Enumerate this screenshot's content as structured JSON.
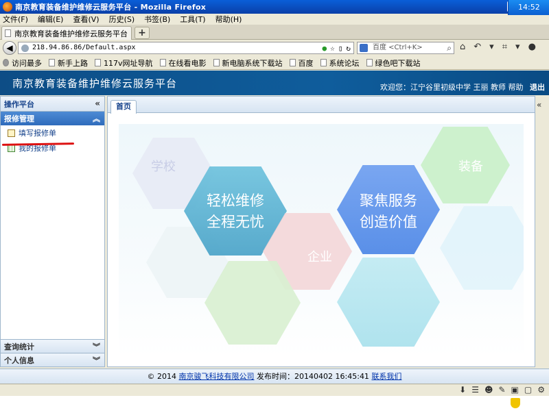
{
  "window": {
    "title": "南京教育装备维护维修云服务平台 - Mozilla Firefox"
  },
  "menu": [
    "文件(F)",
    "编辑(E)",
    "查看(V)",
    "历史(S)",
    "书签(B)",
    "工具(T)",
    "帮助(H)"
  ],
  "tab": {
    "label": "南京教育装备维护维修云服务平台"
  },
  "address": {
    "url": "218.94.86.86/Default.aspx"
  },
  "search": {
    "placeholder": "百度 <Ctrl+K>"
  },
  "bookmarks": [
    "访问最多",
    "新手上路",
    "117v网址导航",
    "在线看电影",
    "新电脑系统下载站",
    "百度",
    "系统论坛",
    "绿色吧下载站"
  ],
  "app": {
    "title": "南京教育装备维护维修云服务平台",
    "welcome": "欢迎您：江宁谷里初级中学 王丽 教师",
    "help": "帮助",
    "logout": "退出"
  },
  "sidebar": {
    "header": "操作平台",
    "section": "报修管理",
    "items": [
      {
        "label": "填写报修单",
        "icon": "edit-form-icon"
      },
      {
        "label": "我的报修单",
        "icon": "list-grid-icon"
      }
    ],
    "bottom": [
      "查询统计",
      "个人信息"
    ]
  },
  "content": {
    "tab": "首页",
    "banner": {
      "hex_texts": [
        "学校",
        "装备",
        "企业"
      ],
      "slogan_left": [
        "轻松维修",
        "全程无忧"
      ],
      "slogan_right": [
        "聚焦服务",
        "创造价值"
      ]
    }
  },
  "footer": {
    "copyright": "© 2014",
    "company": "南京骏飞科技有限公司",
    "release": "发布时间：20140402 16:45:41",
    "contact": "联系我们"
  },
  "tray": {
    "time": "14:52"
  },
  "colors": {
    "header_bg": "#0f5d9c",
    "section_bg": "#2f6cbc",
    "annotation": "#dd1111"
  }
}
